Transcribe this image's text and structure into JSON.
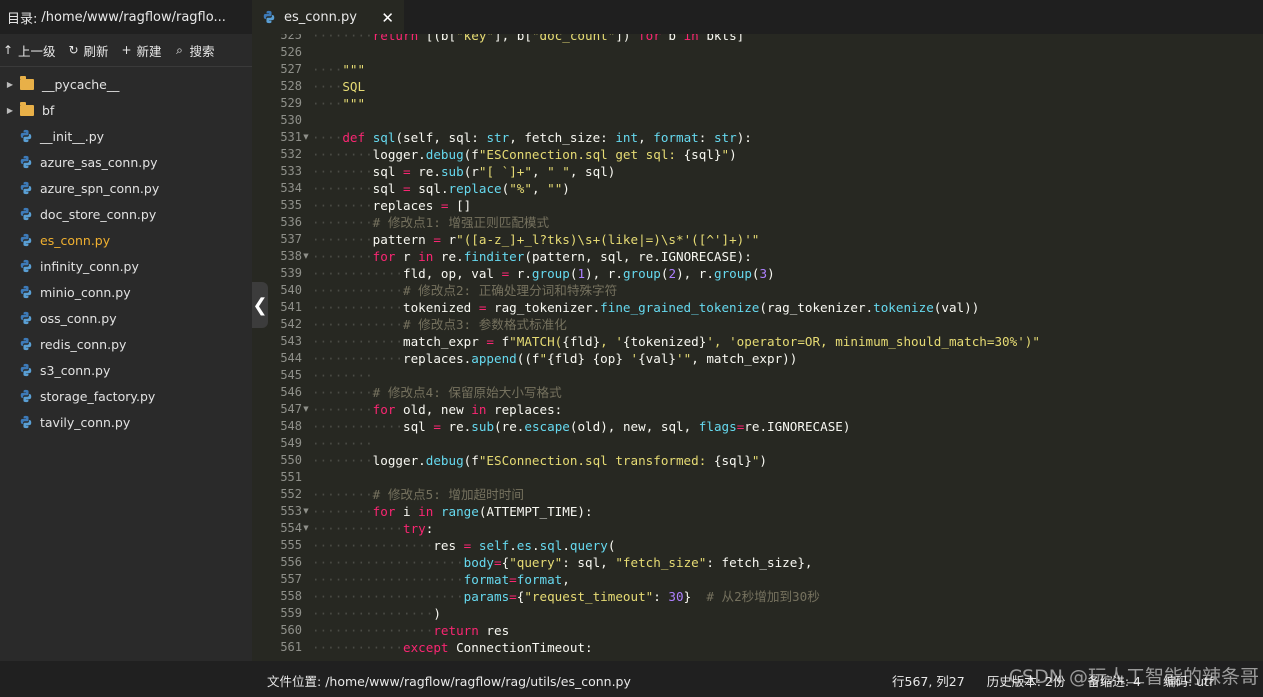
{
  "sidebar": {
    "dir_label": "目录:",
    "dir_path": "/home/www/ragflow/ragflo...",
    "toolbar": [
      {
        "icon": "up-arrow-icon",
        "glyph": "↑",
        "label": "上一级"
      },
      {
        "icon": "refresh-icon",
        "glyph": "↻",
        "label": "刷新"
      },
      {
        "icon": "plus-icon",
        "glyph": "+",
        "label": "新建"
      },
      {
        "icon": "search-icon",
        "glyph": "⌕",
        "label": "搜索"
      }
    ],
    "tree": [
      {
        "type": "folder",
        "name": "__pycache__"
      },
      {
        "type": "folder",
        "name": "bf"
      },
      {
        "type": "file",
        "name": "__init__.py"
      },
      {
        "type": "file",
        "name": "azure_sas_conn.py"
      },
      {
        "type": "file",
        "name": "azure_spn_conn.py"
      },
      {
        "type": "file",
        "name": "doc_store_conn.py"
      },
      {
        "type": "file",
        "name": "es_conn.py",
        "active": true
      },
      {
        "type": "file",
        "name": "infinity_conn.py"
      },
      {
        "type": "file",
        "name": "minio_conn.py"
      },
      {
        "type": "file",
        "name": "oss_conn.py"
      },
      {
        "type": "file",
        "name": "redis_conn.py"
      },
      {
        "type": "file",
        "name": "s3_conn.py"
      },
      {
        "type": "file",
        "name": "storage_factory.py"
      },
      {
        "type": "file",
        "name": "tavily_conn.py"
      }
    ]
  },
  "tab": {
    "title": "es_conn.py",
    "close": "✕"
  },
  "editor": {
    "collapse_glyph": "❮",
    "lines": [
      {
        "n": "525",
        "indent": 2,
        "segs": [
          [
            "k",
            "return"
          ],
          [
            "t",
            " [(b["
          ],
          [
            "s",
            "\"key\""
          ],
          [
            "t",
            "], b["
          ],
          [
            "s",
            "\"doc_count\""
          ],
          [
            "t",
            "]) "
          ],
          [
            "k",
            "for"
          ],
          [
            "t",
            " b "
          ],
          [
            "k",
            "in"
          ],
          [
            "t",
            " bkts]"
          ]
        ]
      },
      {
        "n": "526",
        "indent": 0,
        "segs": []
      },
      {
        "n": "527",
        "indent": 1,
        "segs": [
          [
            "s",
            "\"\"\""
          ]
        ]
      },
      {
        "n": "528",
        "indent": 1,
        "segs": [
          [
            "s",
            "SQL"
          ]
        ]
      },
      {
        "n": "529",
        "indent": 1,
        "segs": [
          [
            "s",
            "\"\"\""
          ]
        ]
      },
      {
        "n": "530",
        "indent": 0,
        "segs": []
      },
      {
        "n": "531",
        "indent": 1,
        "fold": true,
        "segs": [
          [
            "k",
            "def"
          ],
          [
            "t",
            " "
          ],
          [
            "f",
            "sql"
          ],
          [
            "t",
            "(self, sql: "
          ],
          [
            "f",
            "str"
          ],
          [
            "t",
            ", fetch_size: "
          ],
          [
            "f",
            "int"
          ],
          [
            "t",
            ", "
          ],
          [
            "f",
            "format"
          ],
          [
            "t",
            ": "
          ],
          [
            "f",
            "str"
          ],
          [
            "t",
            "):"
          ]
        ]
      },
      {
        "n": "532",
        "indent": 2,
        "segs": [
          [
            "t",
            "logger."
          ],
          [
            "f",
            "debug"
          ],
          [
            "t",
            "(f"
          ],
          [
            "s",
            "\"ESConnection.sql get sql: "
          ],
          [
            "t",
            "{sql}"
          ],
          [
            "s",
            "\""
          ],
          [
            "t",
            ")"
          ]
        ]
      },
      {
        "n": "533",
        "indent": 2,
        "segs": [
          [
            "t",
            "sql "
          ],
          [
            "o",
            "="
          ],
          [
            "t",
            " re."
          ],
          [
            "f",
            "sub"
          ],
          [
            "t",
            "(r"
          ],
          [
            "s",
            "\"[ `]+\""
          ],
          [
            "t",
            ", "
          ],
          [
            "s",
            "\" \""
          ],
          [
            "t",
            ", sql)"
          ]
        ]
      },
      {
        "n": "534",
        "indent": 2,
        "segs": [
          [
            "t",
            "sql "
          ],
          [
            "o",
            "="
          ],
          [
            "t",
            " sql."
          ],
          [
            "f",
            "replace"
          ],
          [
            "t",
            "("
          ],
          [
            "s",
            "\"%\""
          ],
          [
            "t",
            ", "
          ],
          [
            "s",
            "\"\""
          ],
          [
            "t",
            ")"
          ]
        ]
      },
      {
        "n": "535",
        "indent": 2,
        "segs": [
          [
            "t",
            "replaces "
          ],
          [
            "o",
            "="
          ],
          [
            "t",
            " []"
          ]
        ]
      },
      {
        "n": "536",
        "indent": 2,
        "segs": [
          [
            "c",
            "# 修改点1: 增强正则匹配模式"
          ]
        ]
      },
      {
        "n": "537",
        "indent": 2,
        "segs": [
          [
            "t",
            "pattern "
          ],
          [
            "o",
            "="
          ],
          [
            "t",
            " r"
          ],
          [
            "s",
            "\"([a-z_]+_l?tks)\\s+(like|=)\\s*'([^']+)'\""
          ]
        ]
      },
      {
        "n": "538",
        "indent": 2,
        "fold": true,
        "segs": [
          [
            "k",
            "for"
          ],
          [
            "t",
            " r "
          ],
          [
            "k",
            "in"
          ],
          [
            "t",
            " re."
          ],
          [
            "f",
            "finditer"
          ],
          [
            "t",
            "(pattern, sql, re.IGNORECASE):"
          ]
        ]
      },
      {
        "n": "539",
        "indent": 3,
        "segs": [
          [
            "t",
            "fld, op, val "
          ],
          [
            "o",
            "="
          ],
          [
            "t",
            " r."
          ],
          [
            "f",
            "group"
          ],
          [
            "t",
            "("
          ],
          [
            "n",
            "1"
          ],
          [
            "t",
            "), r."
          ],
          [
            "f",
            "group"
          ],
          [
            "t",
            "("
          ],
          [
            "n",
            "2"
          ],
          [
            "t",
            "), r."
          ],
          [
            "f",
            "group"
          ],
          [
            "t",
            "("
          ],
          [
            "n",
            "3"
          ],
          [
            "t",
            ")"
          ]
        ]
      },
      {
        "n": "540",
        "indent": 3,
        "segs": [
          [
            "c",
            "# 修改点2: 正确处理分词和特殊字符"
          ]
        ]
      },
      {
        "n": "541",
        "indent": 3,
        "segs": [
          [
            "t",
            "tokenized "
          ],
          [
            "o",
            "="
          ],
          [
            "t",
            " rag_tokenizer."
          ],
          [
            "f",
            "fine_grained_tokenize"
          ],
          [
            "t",
            "(rag_tokenizer."
          ],
          [
            "f",
            "tokenize"
          ],
          [
            "t",
            "(val))"
          ]
        ]
      },
      {
        "n": "542",
        "indent": 3,
        "segs": [
          [
            "c",
            "# 修改点3: 参数格式标准化"
          ]
        ]
      },
      {
        "n": "543",
        "indent": 3,
        "segs": [
          [
            "t",
            "match_expr "
          ],
          [
            "o",
            "="
          ],
          [
            "t",
            " f"
          ],
          [
            "s",
            "\"MATCH("
          ],
          [
            "t",
            "{fld}"
          ],
          [
            "s",
            ", '"
          ],
          [
            "t",
            "{tokenized}"
          ],
          [
            "s",
            "', 'operator=OR, minimum_should_match=30%')\""
          ]
        ]
      },
      {
        "n": "544",
        "indent": 3,
        "segs": [
          [
            "t",
            "replaces."
          ],
          [
            "f",
            "append"
          ],
          [
            "t",
            "((f"
          ],
          [
            "s",
            "\""
          ],
          [
            "t",
            "{fld} {op}"
          ],
          [
            "s",
            " '"
          ],
          [
            "t",
            "{val}"
          ],
          [
            "s",
            "'\""
          ],
          [
            "t",
            ", match_expr))"
          ]
        ]
      },
      {
        "n": "545",
        "indent": 2,
        "segs": []
      },
      {
        "n": "546",
        "indent": 2,
        "segs": [
          [
            "c",
            "# 修改点4: 保留原始大小写格式"
          ]
        ]
      },
      {
        "n": "547",
        "indent": 2,
        "fold": true,
        "segs": [
          [
            "k",
            "for"
          ],
          [
            "t",
            " old, new "
          ],
          [
            "k",
            "in"
          ],
          [
            "t",
            " replaces:"
          ]
        ]
      },
      {
        "n": "548",
        "indent": 3,
        "segs": [
          [
            "t",
            "sql "
          ],
          [
            "o",
            "="
          ],
          [
            "t",
            " re."
          ],
          [
            "f",
            "sub"
          ],
          [
            "t",
            "(re."
          ],
          [
            "f",
            "escape"
          ],
          [
            "t",
            "(old), new, sql, "
          ],
          [
            "f",
            "flags"
          ],
          [
            "o",
            "="
          ],
          [
            "t",
            "re.IGNORECASE)"
          ]
        ]
      },
      {
        "n": "549",
        "indent": 2,
        "segs": []
      },
      {
        "n": "550",
        "indent": 2,
        "segs": [
          [
            "t",
            "logger."
          ],
          [
            "f",
            "debug"
          ],
          [
            "t",
            "(f"
          ],
          [
            "s",
            "\"ESConnection.sql transformed: "
          ],
          [
            "t",
            "{sql}"
          ],
          [
            "s",
            "\""
          ],
          [
            "t",
            ")"
          ]
        ]
      },
      {
        "n": "551",
        "indent": 0,
        "segs": []
      },
      {
        "n": "552",
        "indent": 2,
        "segs": [
          [
            "c",
            "# 修改点5: 增加超时时间"
          ]
        ]
      },
      {
        "n": "553",
        "indent": 2,
        "fold": true,
        "segs": [
          [
            "k",
            "for"
          ],
          [
            "t",
            " i "
          ],
          [
            "k",
            "in"
          ],
          [
            "t",
            " "
          ],
          [
            "f",
            "range"
          ],
          [
            "t",
            "(ATTEMPT_TIME):"
          ]
        ]
      },
      {
        "n": "554",
        "indent": 3,
        "fold": true,
        "segs": [
          [
            "k",
            "try"
          ],
          [
            "t",
            ":"
          ]
        ]
      },
      {
        "n": "555",
        "indent": 4,
        "segs": [
          [
            "t",
            "res "
          ],
          [
            "o",
            "="
          ],
          [
            "t",
            " "
          ],
          [
            "f",
            "self"
          ],
          [
            "t",
            "."
          ],
          [
            "f",
            "es"
          ],
          [
            "t",
            "."
          ],
          [
            "f",
            "sql"
          ],
          [
            "t",
            "."
          ],
          [
            "f",
            "query"
          ],
          [
            "t",
            "("
          ]
        ]
      },
      {
        "n": "556",
        "indent": 5,
        "segs": [
          [
            "f",
            "body"
          ],
          [
            "o",
            "="
          ],
          [
            "t",
            "{"
          ],
          [
            "s",
            "\"query\""
          ],
          [
            "t",
            ": sql, "
          ],
          [
            "s",
            "\"fetch_size\""
          ],
          [
            "t",
            ": fetch_size},"
          ]
        ]
      },
      {
        "n": "557",
        "indent": 5,
        "segs": [
          [
            "f",
            "format"
          ],
          [
            "o",
            "="
          ],
          [
            "f",
            "format"
          ],
          [
            "t",
            ","
          ]
        ]
      },
      {
        "n": "558",
        "indent": 5,
        "segs": [
          [
            "f",
            "params"
          ],
          [
            "o",
            "="
          ],
          [
            "t",
            "{"
          ],
          [
            "s",
            "\"request_timeout\""
          ],
          [
            "t",
            ": "
          ],
          [
            "n",
            "30"
          ],
          [
            "t",
            "}  "
          ],
          [
            "c",
            "# 从2秒增加到30秒"
          ]
        ]
      },
      {
        "n": "559",
        "indent": 4,
        "segs": [
          [
            "t",
            ")"
          ]
        ]
      },
      {
        "n": "560",
        "indent": 4,
        "segs": [
          [
            "k",
            "return"
          ],
          [
            "t",
            " res"
          ]
        ]
      },
      {
        "n": "561",
        "indent": 3,
        "segs": [
          [
            "k",
            "except"
          ],
          [
            "t",
            " ConnectionTimeout:"
          ]
        ]
      }
    ]
  },
  "status": {
    "path_label": "文件位置:",
    "path": "/home/www/ragflow/ragflow/rag/utils/es_conn.py",
    "position": "行567, 列27",
    "history": "历史版本: 2份",
    "indent": "备缩进: 4",
    "encoding": "编码: utf",
    "watermark": "CSDN @玩人工智能的辣条哥"
  },
  "colors": {
    "editor_bg": "#272822",
    "sidebar_bg": "#2a2a2a",
    "active_file": "#f0b030",
    "keyword": "#f92672",
    "function": "#66d9ef",
    "string": "#e6db74",
    "comment": "#75715e",
    "number": "#ae81ff"
  }
}
